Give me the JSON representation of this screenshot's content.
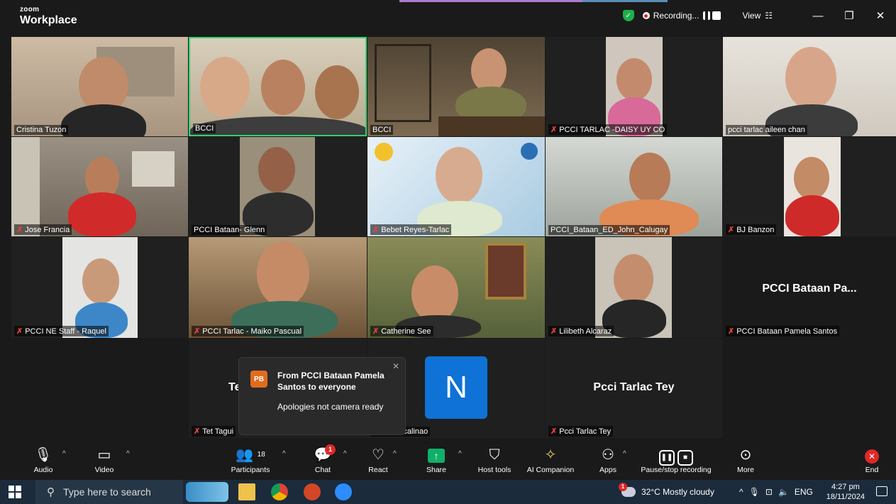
{
  "window": {
    "brand_top": "zoom",
    "brand_bottom": "Workplace",
    "recording_label": "Recording...",
    "view_label": "View",
    "grid_icon": "grid-icon",
    "minimize": "—",
    "restore": "❐",
    "close": "✕"
  },
  "tiles": [
    {
      "name": "Cristina Tuzon",
      "muted": false,
      "bg": "#b9a48c"
    },
    {
      "name": "BCCI",
      "muted": false,
      "bg": "#cbc0a9",
      "active": true
    },
    {
      "name": "BCCI",
      "muted": false,
      "bg": "#6b5a46"
    },
    {
      "name": "PCCI  TARLAC -DAISY UY CO",
      "muted": true,
      "bg": "#2b2b2b"
    },
    {
      "name": "pcci tarlac aileen chan",
      "muted": false,
      "bg": "#d9d4cc"
    },
    {
      "name": "Jose Francia",
      "muted": true,
      "bg": "#8a8174"
    },
    {
      "name": "PCCI Bataan- Glenn",
      "muted": false,
      "bg": "#2b2b2b"
    },
    {
      "name": "Bebet  Reyes-Tarlac",
      "muted": true,
      "bg": "#cfe2ef"
    },
    {
      "name": "PCCI_Bataan_ED_John_Calugay",
      "muted": false,
      "bg": "#c1c5c0"
    },
    {
      "name": "BJ Banzon",
      "muted": true,
      "bg": "#2b2b2b"
    },
    {
      "name": "PCCI NE Staff - Raquel",
      "muted": true,
      "bg": "#2b2b2b"
    },
    {
      "name": "PCCI Tarlac - Maiko Pascual",
      "muted": true,
      "bg": "#8a6a48"
    },
    {
      "name": "Catherine See",
      "muted": true,
      "bg": "#6e7a52"
    },
    {
      "name": "Lilibeth Alcaraz",
      "muted": true,
      "bg": "#2b2b2b"
    },
    {
      "name": "PCCI Bataan Pamela Santos",
      "muted": true,
      "bg": "#1a1a1a",
      "big": "PCCI Bataan Pa..."
    },
    {
      "name": "Tet Tagui",
      "muted": true,
      "big": "Te"
    },
    {
      "name": "Nilda Macalinao",
      "muted": false,
      "avatar": "N"
    },
    {
      "name": "Pcci Tarlac Tey",
      "muted": true,
      "big": "Pcci Tarlac Tey"
    }
  ],
  "toast": {
    "initials": "PB",
    "from": "From PCCI Bataan Pamela Santos to everyone",
    "message": "Apologies not camera ready",
    "close": "✕"
  },
  "toolbar": {
    "audio": "Audio",
    "video": "Video",
    "participants": "Participants",
    "participants_count": "18",
    "chat": "Chat",
    "chat_badge": "1",
    "react": "React",
    "share": "Share",
    "host_tools": "Host tools",
    "ai_companion": "AI Companion",
    "apps": "Apps",
    "pause_recording": "Pause/stop recording",
    "more": "More",
    "end": "End"
  },
  "taskbar": {
    "search_placeholder": "Type here to search",
    "weather": "32°C  Mostly cloudy",
    "weather_badge": "1",
    "lang": "ENG",
    "time": "4:27 pm",
    "date": "18/11/2024"
  },
  "colors": {
    "active_speaker": "#2ed573",
    "muted_icon": "#e6413b",
    "share": "#10b06a",
    "end": "#e02828",
    "avatar_blue": "#0e72d6"
  }
}
